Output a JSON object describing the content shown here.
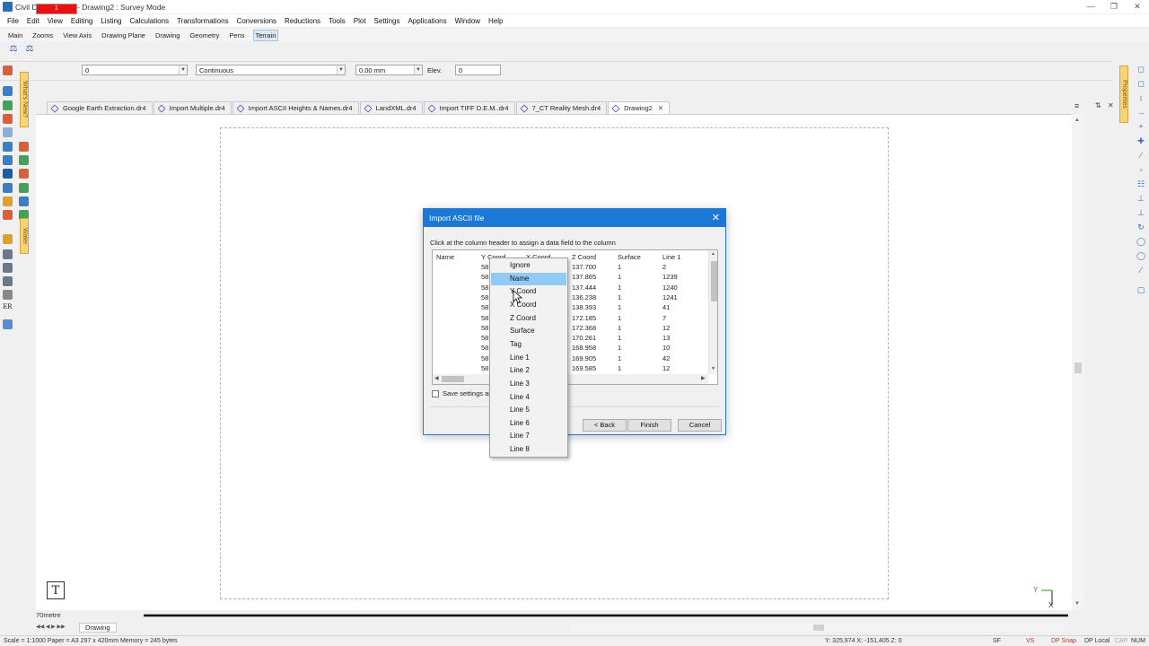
{
  "window": {
    "title": "Civil Designer 8.3 - Drawing2 : Survey Mode"
  },
  "menubar": [
    "File",
    "Edit",
    "View",
    "Editing",
    "Listing",
    "Calculations",
    "Transformations",
    "Conversions",
    "Reductions",
    "Tools",
    "Plot",
    "Settings",
    "Applications",
    "Window",
    "Help"
  ],
  "toolbar_tabs": [
    "Main",
    "Zooms",
    "View Axis",
    "Drawing Plane",
    "Drawing",
    "Geometry",
    "Pens",
    "Terrain"
  ],
  "active_toolbar_tab": "Terrain",
  "properties_bar": {
    "color_hex": "#ee1010",
    "color_value": "1",
    "layer_value": "0",
    "linetype_value": "Continuous",
    "width_value": "0.00 mm",
    "elev_label": "Elev.",
    "elev_value": "0"
  },
  "side_tabs": {
    "left_top": "What's New?",
    "left_bottom": "Water",
    "right": "Properties"
  },
  "doc_tabs": [
    {
      "label": "Google Earth Extraction.dr4",
      "active": false
    },
    {
      "label": "Import Multiple.dr4",
      "active": false
    },
    {
      "label": "Import ASCII Heights & Names.dr4",
      "active": false
    },
    {
      "label": "LandXML.dr4",
      "active": false
    },
    {
      "label": "Import TIFF D.E.M..dr4",
      "active": false
    },
    {
      "label": "7_CT Reality Mesh.dr4",
      "active": false
    },
    {
      "label": "Drawing2",
      "active": true
    }
  ],
  "scale_label": "70metre",
  "drawing_tab": "Drawing",
  "status": {
    "left": "Scale = 1:1000  Paper = A3 297 x 420mm  Memory = 245 bytes",
    "coords": "Y: 325,974 X: -151,405 Z: 0",
    "indicators": [
      "SF",
      "VS",
      "DP Snap",
      "DP Local",
      "CAP",
      "NUM"
    ]
  },
  "axis_labels": {
    "y": "Y",
    "x": "X"
  },
  "dialog": {
    "title": "Import ASCII file",
    "hint": "Click at the column header to assign a data field to the column",
    "columns": [
      "Name",
      "Y Coord",
      "X Coord",
      "Z Coord",
      "Surface",
      "Line 1"
    ],
    "rows": [
      {
        "y": "58",
        "z": "137.700",
        "s": "1",
        "l": "2"
      },
      {
        "y": "58",
        "z": "137.865",
        "s": "1",
        "l": "1239"
      },
      {
        "y": "58",
        "z": "137.444",
        "s": "1",
        "l": "1240"
      },
      {
        "y": "58",
        "z": "136.238",
        "s": "1",
        "l": "1241"
      },
      {
        "y": "58",
        "z": "138.393",
        "s": "1",
        "l": "41"
      },
      {
        "y": "58",
        "z": "172.185",
        "s": "1",
        "l": "7"
      },
      {
        "y": "58",
        "z": "172.368",
        "s": "1",
        "l": "12"
      },
      {
        "y": "58",
        "z": "170.261",
        "s": "1",
        "l": "13"
      },
      {
        "y": "58",
        "z": "168.958",
        "s": "1",
        "l": "10"
      },
      {
        "y": "58",
        "z": "169.905",
        "s": "1",
        "l": "42"
      },
      {
        "y": "58",
        "z": "169.585",
        "s": "1",
        "l": "12"
      }
    ],
    "save_label": "Save settings as",
    "back_label": "< Back",
    "finish_label": "Finish",
    "cancel_label": "Cancel"
  },
  "context_menu": {
    "items": [
      "Ignore",
      "Name",
      "Y Coord",
      "X Coord",
      "Z Coord",
      "Surface",
      "Tag",
      "Line 1",
      "Line 2",
      "Line 3",
      "Line 4",
      "Line 5",
      "Line 6",
      "Line 7",
      "Line 8"
    ],
    "highlighted": "Name"
  }
}
